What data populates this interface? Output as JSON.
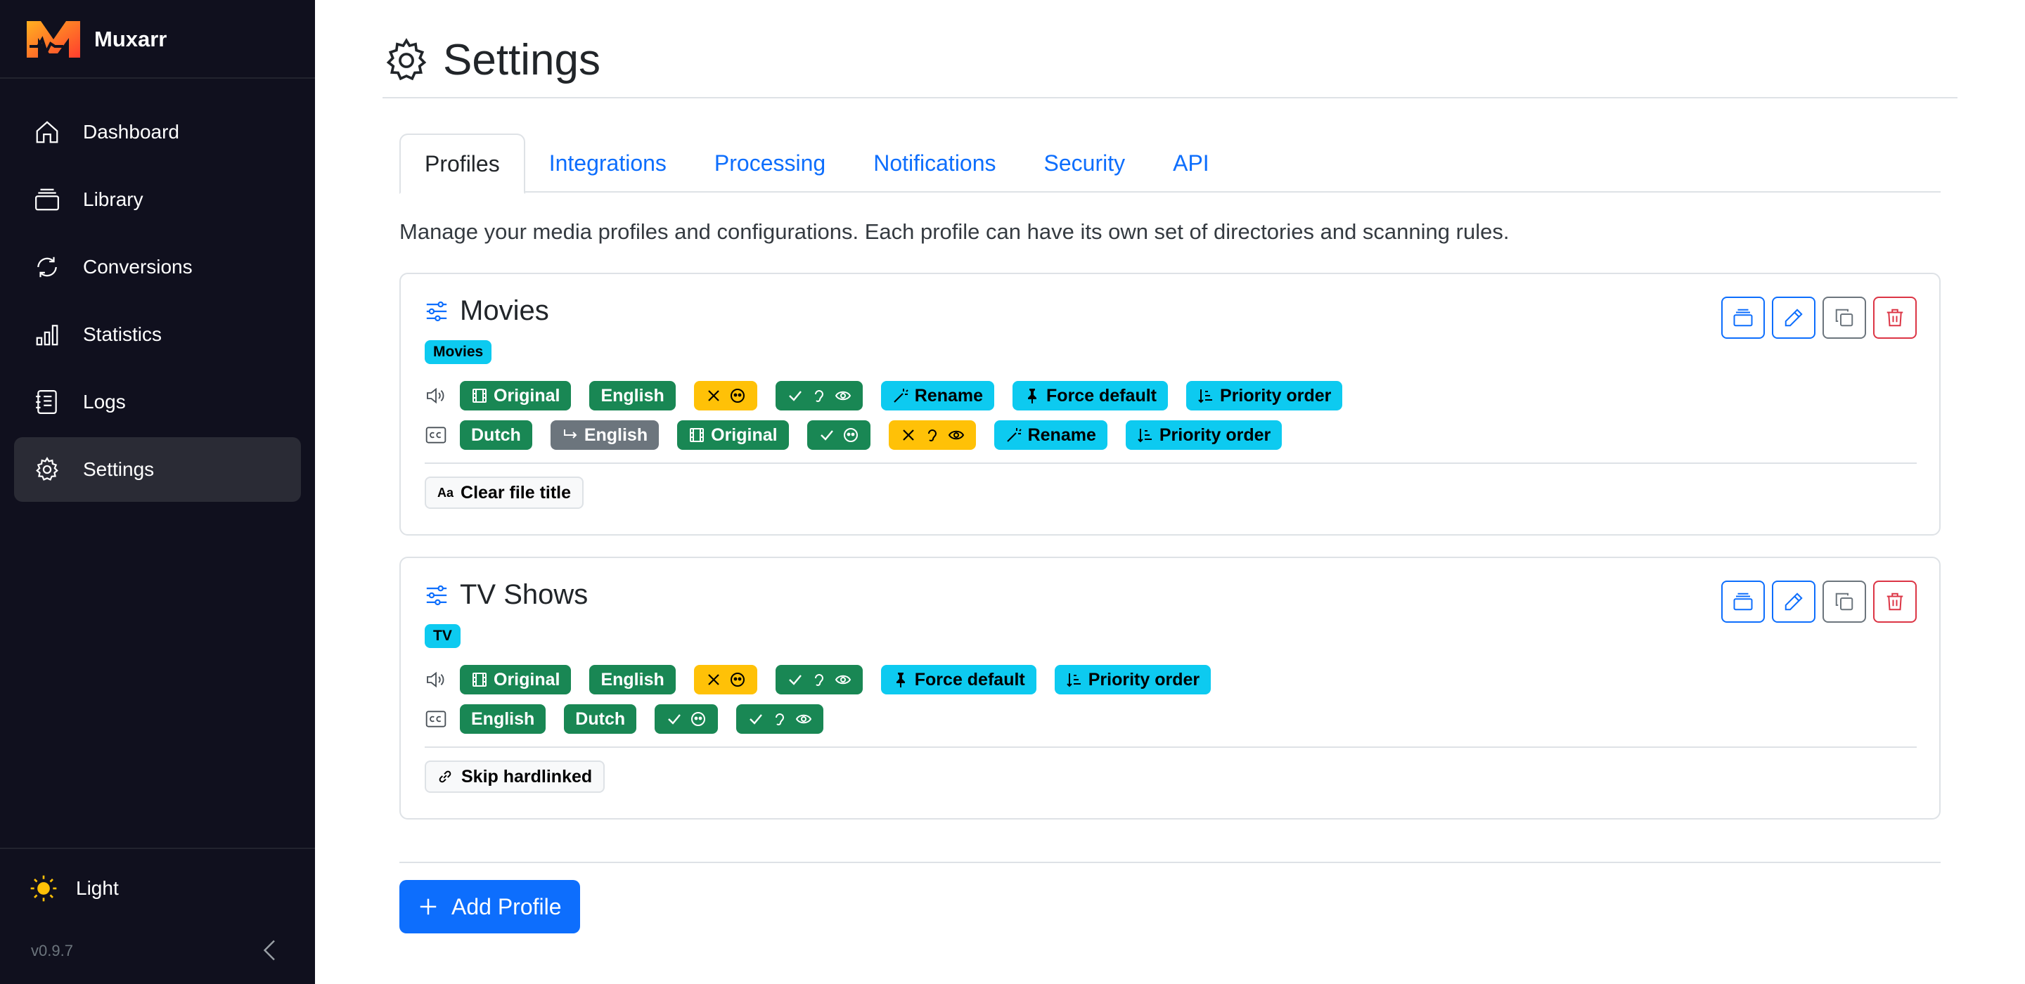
{
  "app": {
    "name": "Muxarr",
    "version": "v0.9.7",
    "theme_label": "Light"
  },
  "sidebar": {
    "items": [
      {
        "label": "Dashboard"
      },
      {
        "label": "Library"
      },
      {
        "label": "Conversions"
      },
      {
        "label": "Statistics"
      },
      {
        "label": "Logs"
      },
      {
        "label": "Settings"
      }
    ]
  },
  "page": {
    "title": "Settings",
    "intro": "Manage your media profiles and configurations. Each profile can have its own set of directories and scanning rules.",
    "tabs": [
      {
        "label": "Profiles"
      },
      {
        "label": "Integrations"
      },
      {
        "label": "Processing"
      },
      {
        "label": "Notifications"
      },
      {
        "label": "Security"
      },
      {
        "label": "API"
      }
    ],
    "add_profile_label": "Add Profile"
  },
  "profiles": [
    {
      "name": "Movies",
      "type": "Movies",
      "audio": {
        "original": "Original",
        "lang": "English",
        "rename": "Rename",
        "force_default": "Force default",
        "priority": "Priority order"
      },
      "subs": {
        "lang1": "Dutch",
        "fallback": "English",
        "original": "Original",
        "rename": "Rename",
        "priority": "Priority order"
      },
      "option": "Clear file title",
      "option_icon": "Aa"
    },
    {
      "name": "TV Shows",
      "type": "TV",
      "audio": {
        "original": "Original",
        "lang": "English",
        "force_default": "Force default",
        "priority": "Priority order"
      },
      "subs": {
        "lang1": "English",
        "lang2": "Dutch"
      },
      "option": "Skip hardlinked"
    }
  ],
  "colors": {
    "sidebar_bg": "#10101e",
    "primary": "#0d6efd",
    "success": "#198754",
    "warning": "#ffc107",
    "info": "#0dcaf0",
    "danger": "#dc3545"
  }
}
